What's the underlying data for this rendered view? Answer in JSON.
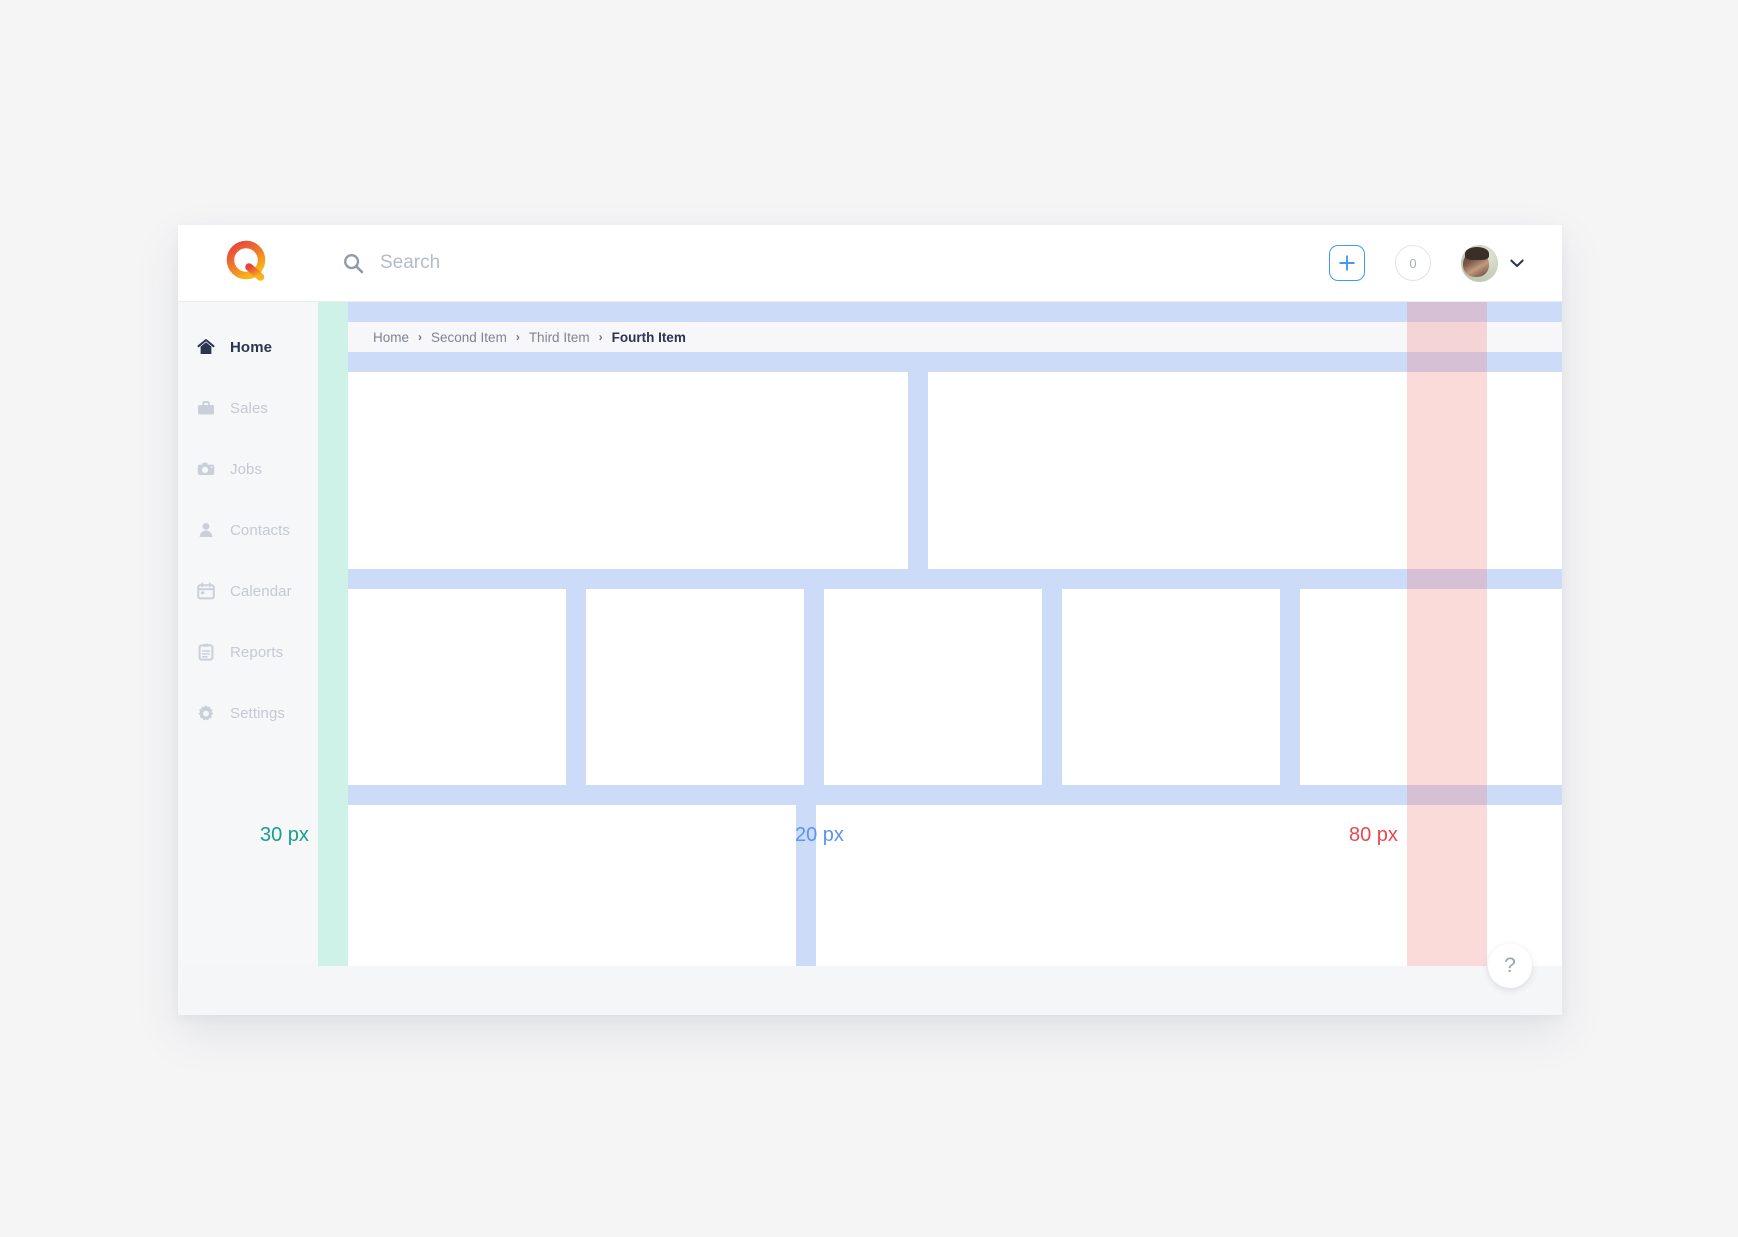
{
  "brand": {
    "logo_name": "quoter-q-logo",
    "gradient_start": "#e8413f",
    "gradient_end": "#f5a623"
  },
  "topbar": {
    "search": {
      "placeholder": "Search",
      "value": "",
      "icon": "search-icon"
    },
    "add_button": {
      "icon": "plus-icon",
      "label": "+"
    },
    "notification_badge": {
      "count": "0"
    },
    "avatar": {
      "icon": "user-avatar",
      "chevron": "chevron-down-icon"
    }
  },
  "sidebar": {
    "items": [
      {
        "label": "Home",
        "icon": "home-icon",
        "active": true
      },
      {
        "label": "Sales",
        "icon": "briefcase-icon",
        "active": false
      },
      {
        "label": "Jobs",
        "icon": "camera-icon",
        "active": false
      },
      {
        "label": "Contacts",
        "icon": "person-icon",
        "active": false
      },
      {
        "label": "Calendar",
        "icon": "calendar-icon",
        "active": false
      },
      {
        "label": "Reports",
        "icon": "clipboard-icon",
        "active": false
      },
      {
        "label": "Settings",
        "icon": "gear-icon",
        "active": false
      }
    ]
  },
  "breadcrumb": {
    "separator": "›",
    "items": [
      {
        "label": "Home",
        "current": false
      },
      {
        "label": "Second Item",
        "current": false
      },
      {
        "label": "Third Item",
        "current": false
      },
      {
        "label": "Fourth Item",
        "current": true
      }
    ]
  },
  "measurements": [
    {
      "name": "left-gutter",
      "label": "30 px",
      "color": "#16a08c"
    },
    {
      "name": "inner-gutter",
      "label": "20 px",
      "color": "#5a93f0"
    },
    {
      "name": "right-gutter",
      "label": "80 px",
      "color": "#e8494c"
    }
  ],
  "footer": {
    "help_button": {
      "label": "?",
      "icon": "question-mark-icon"
    }
  },
  "colors": {
    "grid_gutter": "#ccdcf8",
    "card": "#ffffff",
    "accent_blue": "#3f9bf5",
    "sidebar_bg": "#f6f7f8",
    "footer_bg": "#f5f6f7",
    "page_bg": "#f5f5f6"
  }
}
